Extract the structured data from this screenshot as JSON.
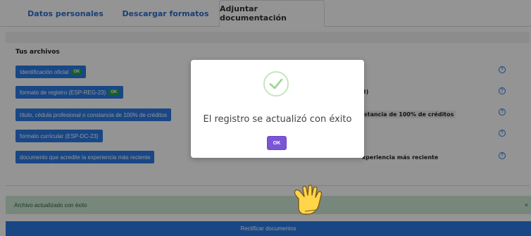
{
  "tabs": [
    {
      "label": "Datos personales"
    },
    {
      "label": "Descargar formatos"
    },
    {
      "label": "Adjuntar documentación"
    }
  ],
  "section": {
    "title": "Tus archivos"
  },
  "files": [
    {
      "label": "Identificación oficial",
      "badge": "OK"
    },
    {
      "label": "formato de registro (ESP-REG-23)",
      "badge": "OK",
      "right": "3)"
    },
    {
      "label": "título, cédula profesional o constancia de 100% de créditos",
      "right": "stancia de 100% de créditos"
    },
    {
      "label": "formato curricular (ESP-DC-23)"
    },
    {
      "label": "documento que acredite la experiencia más reciente",
      "right": "xperiencia más reciente"
    }
  ],
  "help_icon": "?",
  "alert": {
    "text": "Archivo actualizado con éxito",
    "close": "×"
  },
  "footer_button": {
    "label": "Rectificar documentos"
  },
  "modal": {
    "message": "El registro se actualizó con éxito",
    "ok_label": "OK",
    "icon": "check-circle-icon"
  },
  "colors": {
    "tab_link": "#2c6fd1",
    "file_button": "#2c7be5",
    "ok_badge": "#22a745",
    "modal_button": "#7a56d6",
    "success_check": "#a8d8a0",
    "alert_bg": "#cfe8d6"
  }
}
